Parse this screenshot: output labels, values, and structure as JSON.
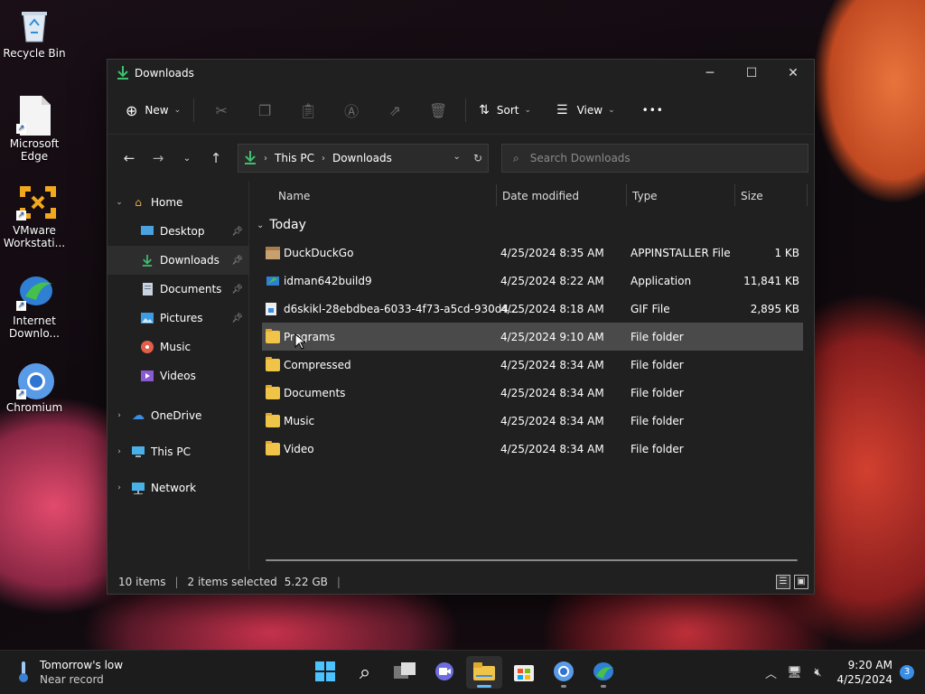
{
  "desktop": {
    "icons": [
      {
        "label": "Recycle Bin"
      },
      {
        "label": "Microsoft Edge"
      },
      {
        "label": "VMware Workstati..."
      },
      {
        "label": "Internet Downlo..."
      },
      {
        "label": "Chromium"
      }
    ]
  },
  "window": {
    "title": "Downloads",
    "controls": {
      "minimize": "─",
      "maximize": "☐",
      "close": "✕"
    }
  },
  "toolbar": {
    "new_label": "New",
    "sort_label": "Sort",
    "view_label": "View",
    "more_label": "•••"
  },
  "address": {
    "crumbs": [
      "This PC",
      "Downloads"
    ]
  },
  "search": {
    "placeholder": "Search Downloads"
  },
  "sidebar": {
    "items": [
      {
        "label": "Home"
      },
      {
        "label": "Desktop"
      },
      {
        "label": "Downloads"
      },
      {
        "label": "Documents"
      },
      {
        "label": "Pictures"
      },
      {
        "label": "Music"
      },
      {
        "label": "Videos"
      },
      {
        "label": "OneDrive"
      },
      {
        "label": "This PC"
      },
      {
        "label": "Network"
      }
    ]
  },
  "columns": {
    "name": "Name",
    "date": "Date modified",
    "type": "Type",
    "size": "Size"
  },
  "group": {
    "label": "Today"
  },
  "files": [
    {
      "name": "DuckDuckGo",
      "date": "4/25/2024 8:35 AM",
      "type": "APPINSTALLER File",
      "size": "1 KB"
    },
    {
      "name": "idman642build9",
      "date": "4/25/2024 8:22 AM",
      "type": "Application",
      "size": "11,841 KB"
    },
    {
      "name": "d6skikl-28ebdbea-6033-4f73-a5cd-930d4...",
      "date": "4/25/2024 8:18 AM",
      "type": "GIF File",
      "size": "2,895 KB"
    },
    {
      "name": "Programs",
      "date": "4/25/2024 9:10 AM",
      "type": "File folder",
      "size": ""
    },
    {
      "name": "Compressed",
      "date": "4/25/2024 8:34 AM",
      "type": "File folder",
      "size": ""
    },
    {
      "name": "Documents",
      "date": "4/25/2024 8:34 AM",
      "type": "File folder",
      "size": ""
    },
    {
      "name": "Music",
      "date": "4/25/2024 8:34 AM",
      "type": "File folder",
      "size": ""
    },
    {
      "name": "Video",
      "date": "4/25/2024 8:34 AM",
      "type": "File folder",
      "size": ""
    }
  ],
  "status": {
    "items": "10 items",
    "selected": "2 items selected",
    "size": "5.22 GB",
    "divider": "|"
  },
  "taskbar": {
    "weather_title": "Tomorrow's low",
    "weather_sub": "Near record",
    "time": "9:20 AM",
    "date": "4/25/2024",
    "badge": "3"
  },
  "colors": {
    "accent": "#60b8ff",
    "download_green": "#3fbf6f",
    "folder": "#f0c448"
  }
}
